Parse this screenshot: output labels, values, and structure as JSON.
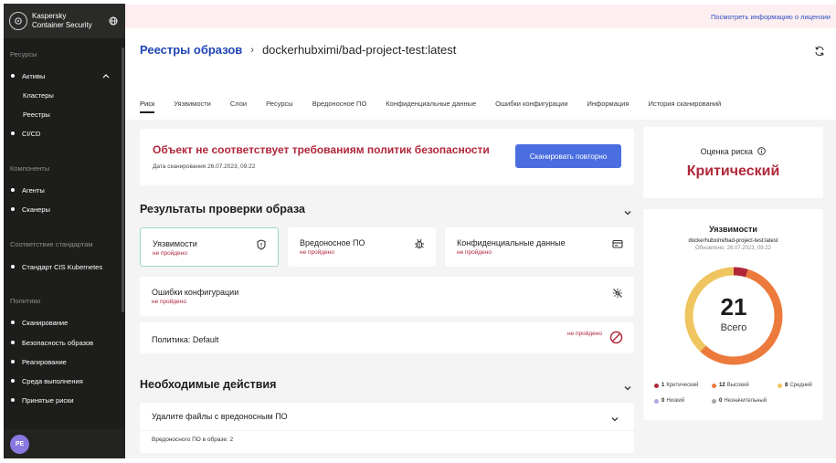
{
  "sidebar": {
    "brand_line1": "Kaspersky",
    "brand_line2": "Container Security",
    "sections": [
      "Ресурсы",
      "Компоненты",
      "Соответствие стандартам",
      "Политики"
    ],
    "items": {
      "assets": "Активы",
      "clusters": "Кластеры",
      "registries": "Реестры",
      "cicd": "CI/CD",
      "agents": "Агенты",
      "scanners": "Сканеры",
      "cis": "Стандарт CIS Kubernetes",
      "scanning": "Сканирование",
      "image_security": "Безопасность образов",
      "response": "Реагирование",
      "runtime": "Среда выполнения",
      "accepted_risks": "Принятые риски"
    },
    "avatar": "PE"
  },
  "banner": {
    "link": "Посмотреть информацию о лицензии"
  },
  "breadcrumb": {
    "parent": "Реестры образов",
    "current": "dockerhubximi/bad-project-test:latest"
  },
  "tabs": [
    "Риск",
    "Уязвимости",
    "Слои",
    "Ресурсы",
    "Вредоносное ПО",
    "Конфиденциальные данные",
    "Ошибки конфигурации",
    "Информация",
    "История сканирований"
  ],
  "alert": {
    "title": "Объект не соответствует требованиям политик безопасности",
    "date": "Дата сканирования 26.07.2023, 09:22",
    "button": "Сканировать повторно"
  },
  "risk": {
    "label": "Оценка риска",
    "value": "Критический"
  },
  "results": {
    "title": "Результаты проверки образа",
    "vulnerabilities": {
      "name": "Уязвимости",
      "status": "не пройдено"
    },
    "malware": {
      "name": "Вредоносное ПО",
      "status": "не пройдено"
    },
    "sensitive": {
      "name": "Конфиденциальные данные",
      "status": "не пройдено"
    },
    "misconfig": {
      "name": "Ошибки конфигурации",
      "status": "не пройдено"
    },
    "policy": {
      "name": "Политика: Default",
      "status": "не пройдено"
    }
  },
  "actions": {
    "title": "Необходимые действия",
    "item": "Удалите файлы с вредоносным ПО",
    "sub": "Вредоносного ПО в образе: 2"
  },
  "vuln_summary": {
    "title": "Уязвимости",
    "image": "dockerhubximi/bad-project-test:latest",
    "updated": "Обновлено: 26.07.2023, 09:22",
    "total": "21",
    "total_label": "Всего",
    "legend": [
      {
        "count": "1",
        "label": "Критический",
        "value": 1,
        "color": "#b0273a"
      },
      {
        "count": "12",
        "label": "Высокий",
        "value": 12,
        "color": "#ec7a3c"
      },
      {
        "count": "8",
        "label": "Средний",
        "value": 8,
        "color": "#efc55f"
      },
      {
        "count": "0",
        "label": "Низкий",
        "value": 0,
        "color": "#b3a9e6"
      },
      {
        "count": "0",
        "label": "Незначительный",
        "value": 0,
        "color": "#a8a8a8"
      }
    ]
  }
}
